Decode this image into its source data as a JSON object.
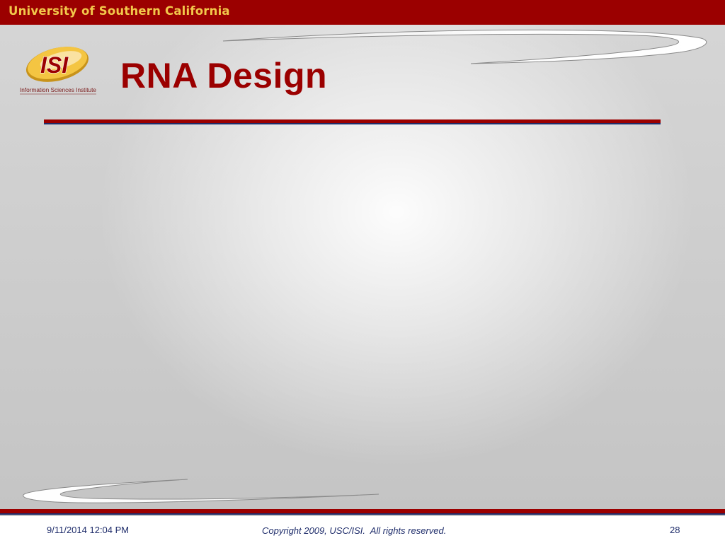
{
  "header": {
    "institution": "University of Southern California"
  },
  "logo": {
    "text": "ISI",
    "subtitle": "Information Sciences Institute",
    "colors": {
      "ring": "#f4c542",
      "ring_shadow": "#c8931a",
      "letters": "#9b0000"
    }
  },
  "slide": {
    "title": "RNA Design"
  },
  "footer": {
    "date": "9/11/2014 12:04 PM",
    "copyright": "Copyright 2009, USC/ISI.  All rights reserved.",
    "page_number": "28"
  },
  "colors": {
    "brand_red": "#9b0000",
    "accent_gold": "#f2c84b",
    "accent_blue": "#1f2d6b"
  }
}
